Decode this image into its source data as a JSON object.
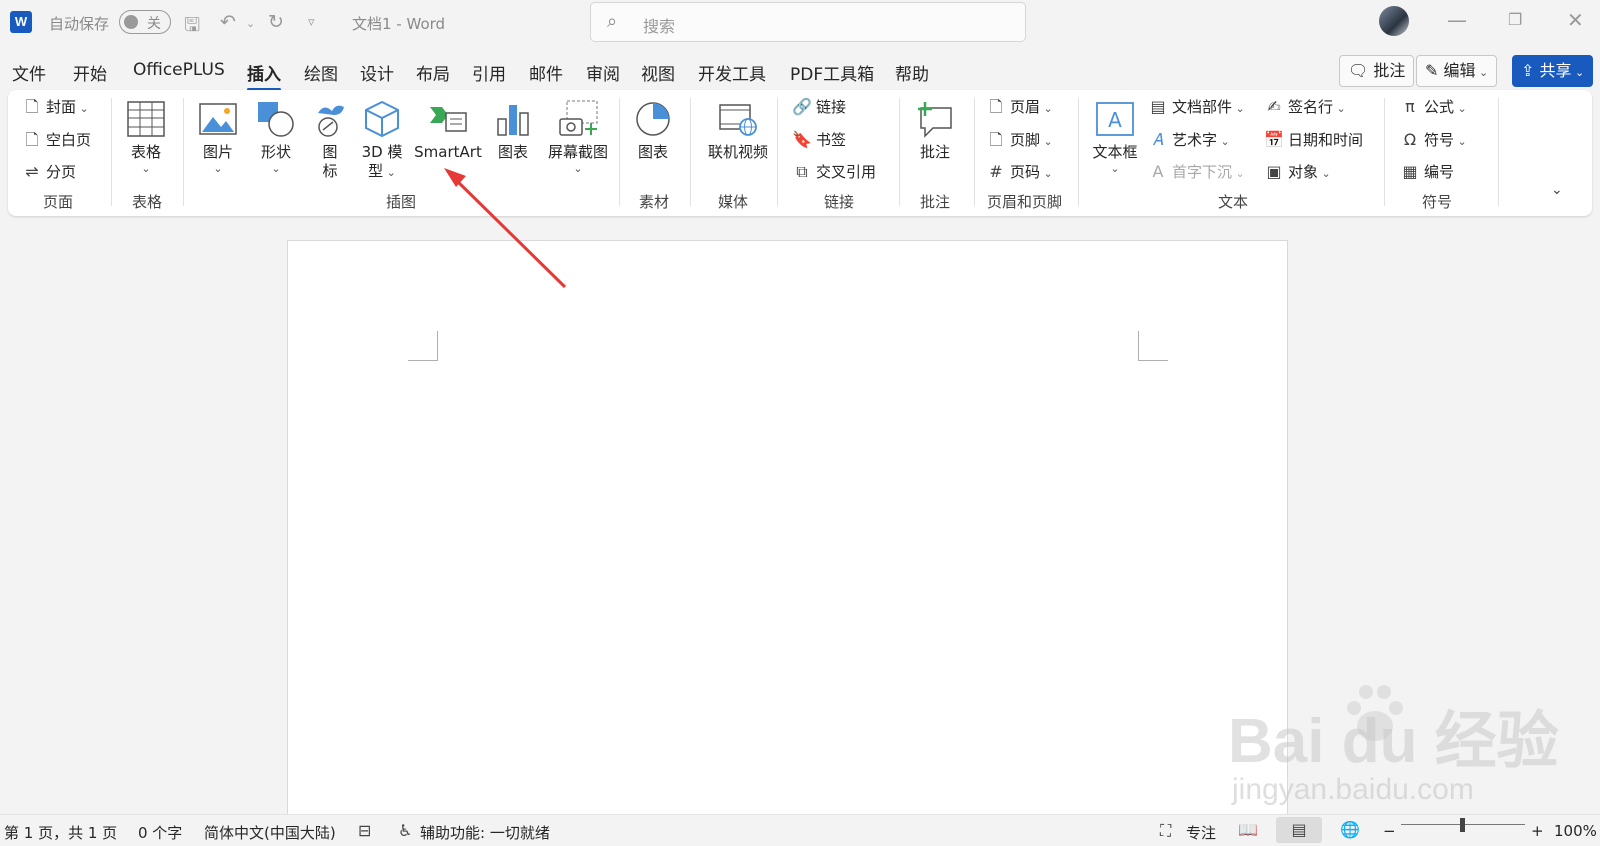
{
  "titlebar": {
    "app_letter": "W",
    "autosave_label": "自动保存",
    "autosave_state": "关",
    "document_title": "文档1  -  Word",
    "search_placeholder": "搜索"
  },
  "tabs": [
    "文件",
    "开始",
    "OfficePLUS",
    "插入",
    "绘图",
    "设计",
    "布局",
    "引用",
    "邮件",
    "审阅",
    "视图",
    "开发工具",
    "PDF工具箱",
    "帮助"
  ],
  "active_tab": "插入",
  "right_buttons": {
    "comments": "批注",
    "editing": "编辑",
    "share": "共享"
  },
  "ribbon": {
    "pages": {
      "cover": "封面",
      "blank": "空白页",
      "break": "分页",
      "group": "页面"
    },
    "tables": {
      "table": "表格",
      "group": "表格"
    },
    "illustrations": {
      "picture": "图片",
      "shapes": "形状",
      "icons_1": "图",
      "icons_2": "标",
      "model_1": "3D 模",
      "model_2": "型",
      "smartart": "SmartArt",
      "chart": "图表",
      "screenshot": "屏幕截图",
      "group": "插图"
    },
    "media_assets": {
      "chart": "图表",
      "group": "素材"
    },
    "media": {
      "video": "联机视频",
      "group": "媒体"
    },
    "links": {
      "link": "链接",
      "bookmark": "书签",
      "crossref": "交叉引用",
      "group": "链接"
    },
    "comments": {
      "comment": "批注",
      "group": "批注"
    },
    "header_footer": {
      "header": "页眉",
      "footer": "页脚",
      "page_number": "页码",
      "group": "页眉和页脚"
    },
    "text": {
      "textbox": "文本框",
      "quickparts": "文档部件",
      "wordart": "艺术字",
      "dropcap": "首字下沉",
      "signature": "签名行",
      "datetime": "日期和时间",
      "object": "对象",
      "group": "文本"
    },
    "symbols": {
      "equation": "公式",
      "symbol": "符号",
      "number": "编号",
      "group": "符号"
    }
  },
  "statusbar": {
    "page": "第 1 页，共 1 页",
    "words": "0 个字",
    "language": "简体中文(中国大陆)",
    "accessibility": "辅助功能: 一切就绪",
    "focus": "专注",
    "zoom": "100%",
    "zoom_minus": "−",
    "zoom_plus": "+"
  },
  "watermark": {
    "brand": "Bai  du 经验",
    "url": "jingyan.baidu.com"
  },
  "colors": {
    "accent": "#185abd",
    "annotation_arrow": "#e53935"
  }
}
